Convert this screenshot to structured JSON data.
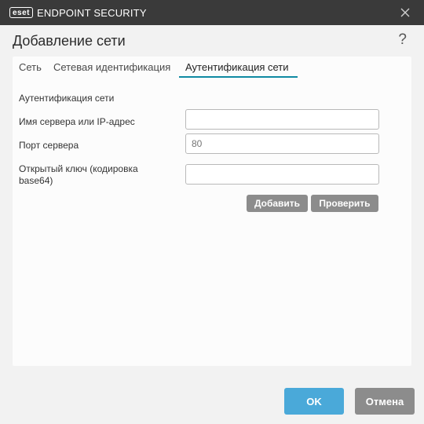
{
  "window": {
    "logo_badge": "eset",
    "app_name": "ENDPOINT SECURITY",
    "close_icon": "close-icon"
  },
  "dialog": {
    "title": "Добавление сети",
    "help": "?"
  },
  "tabs": [
    {
      "label": "Сеть",
      "active": false
    },
    {
      "label": "Сетевая идентификация",
      "active": false
    },
    {
      "label": "Аутентификация сети",
      "active": true
    }
  ],
  "form": {
    "heading": "Аутентификация сети",
    "server_label": "Имя сервера или IP-адрес",
    "server_value": "",
    "port_label": "Порт сервера",
    "port_placeholder": "80",
    "key_label_line1": "Открытый ключ (кодировка",
    "key_label_line2": "base64)",
    "key_value": "",
    "add_button": "Добавить",
    "check_button": "Проверить"
  },
  "footer": {
    "ok_button": "OK",
    "cancel_button": "Отмена"
  },
  "colors": {
    "titlebar": "#3a3a3a",
    "accent": "#0f8aa3",
    "ok_button": "#4aa9d9",
    "cancel_button": "#8c8c8c"
  }
}
